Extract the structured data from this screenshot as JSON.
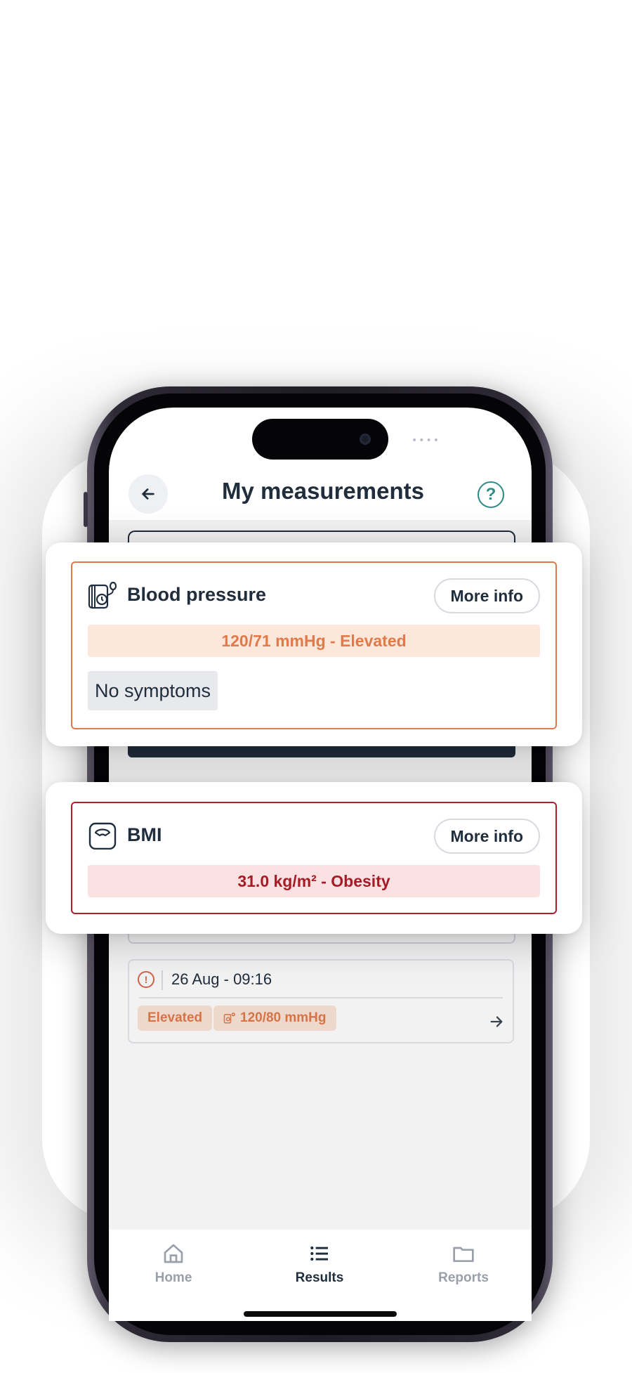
{
  "header": {
    "title": "My measurements",
    "back_icon": "arrow-left-icon",
    "help_label": "?"
  },
  "blood_pressure_card": {
    "icon": "blood-pressure-monitor-icon",
    "title": "Blood pressure",
    "more_info_label": "More info",
    "result": "120/71 mmHg - Elevated",
    "symptoms": "No symptoms",
    "accent_color": "#e07a4a"
  },
  "bmi_card": {
    "icon": "scale-icon",
    "title": "BMI",
    "more_info_label": "More info",
    "result": "31.0 kg/m² - Obesity",
    "accent_color": "#b01e2a"
  },
  "history": {
    "alert_label": "!",
    "date": "26 Aug - 09:16",
    "status": "Elevated",
    "value": "120/80 mmHg",
    "arrow_icon": "arrow-right-icon"
  },
  "bottom_nav": {
    "items": [
      {
        "label": "Home",
        "icon": "home-icon",
        "active": false
      },
      {
        "label": "Results",
        "icon": "list-icon",
        "active": true
      },
      {
        "label": "Reports",
        "icon": "folder-icon",
        "active": false
      }
    ]
  },
  "status_bar": {
    "dots": "••••"
  }
}
